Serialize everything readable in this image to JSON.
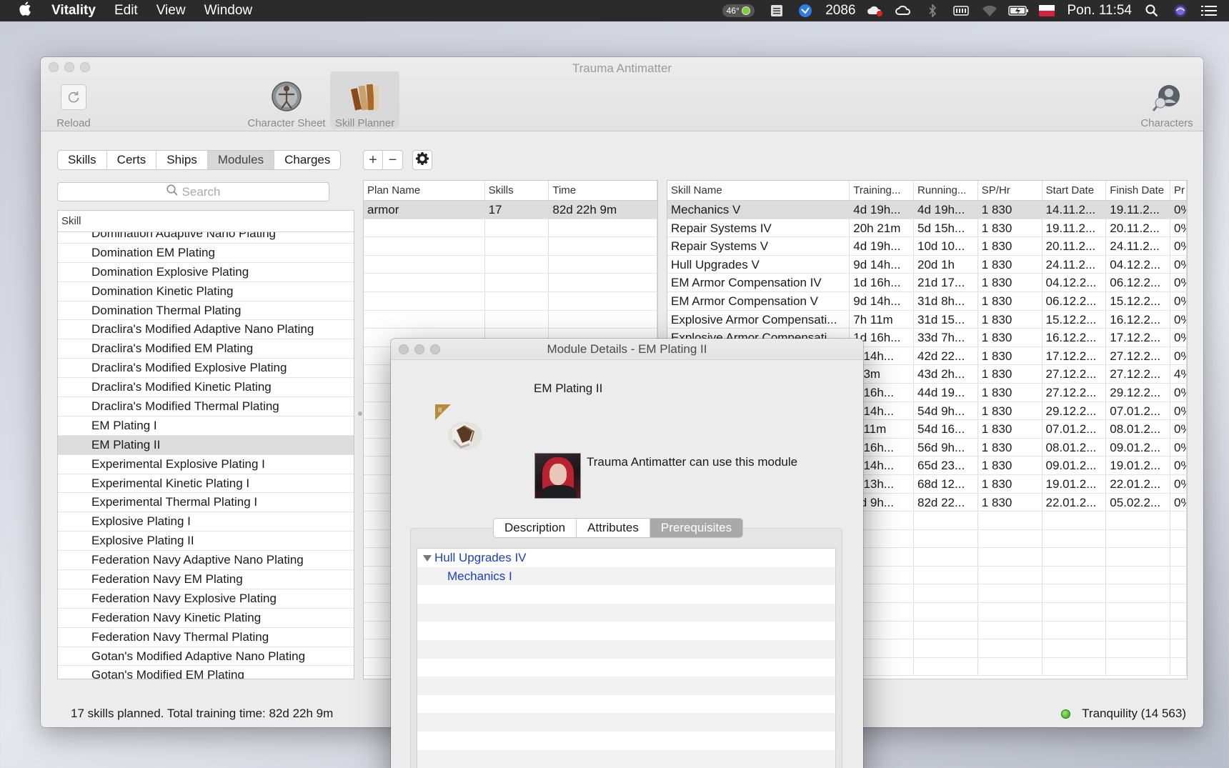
{
  "menubar": {
    "app": "Vitality",
    "menus": [
      "Edit",
      "View",
      "Window"
    ],
    "temp": "46°",
    "count": "2086",
    "clock": "Pon. 11:54"
  },
  "window": {
    "title": "Trauma Antimatter",
    "toolbar": {
      "reload": "Reload",
      "character_sheet": "Character Sheet",
      "skill_planner": "Skill Planner",
      "characters": "Characters"
    },
    "segments": [
      "Skills",
      "Certs",
      "Ships",
      "Modules",
      "Charges"
    ],
    "selected_segment": "Modules",
    "search_placeholder": "Search",
    "left_table": {
      "header": "Skill",
      "rows": [
        "Domination Adaptive Nano Plating",
        "Domination EM Plating",
        "Domination Explosive Plating",
        "Domination Kinetic Plating",
        "Domination Thermal Plating",
        "Draclira's Modified Adaptive Nano Plating",
        "Draclira's Modified EM Plating",
        "Draclira's Modified Explosive Plating",
        "Draclira's Modified Kinetic Plating",
        "Draclira's Modified Thermal Plating",
        "EM Plating I",
        "EM Plating II",
        "Experimental Explosive Plating I",
        "Experimental Kinetic Plating I",
        "Experimental Thermal Plating I",
        "Explosive Plating I",
        "Explosive Plating II",
        "Federation Navy Adaptive Nano Plating",
        "Federation Navy EM Plating",
        "Federation Navy Explosive Plating",
        "Federation Navy Kinetic Plating",
        "Federation Navy Thermal Plating",
        "Gotan's Modified Adaptive Nano Plating",
        "Gotan's Modified EM Plating"
      ],
      "selected": "EM Plating II"
    },
    "plan_table": {
      "headers": [
        "Plan Name",
        "Skills",
        "Time"
      ],
      "rows": [
        [
          "armor",
          "17",
          "82d 22h 9m"
        ]
      ]
    },
    "skill_table": {
      "headers": [
        "Skill Name",
        "Training...",
        "Running...",
        "SP/Hr",
        "Start Date",
        "Finish Date",
        "Pr"
      ],
      "rows": [
        [
          "Mechanics V",
          "4d 19h...",
          "4d 19h...",
          "1 830",
          "14.11.2...",
          "19.11.2...",
          "0%"
        ],
        [
          "Repair Systems IV",
          "20h 21m",
          "5d 15h...",
          "1 830",
          "19.11.2...",
          "20.11.2...",
          "0%"
        ],
        [
          "Repair Systems V",
          "4d 19h...",
          "10d 10...",
          "1 830",
          "20.11.2...",
          "24.11.2...",
          "0%"
        ],
        [
          "Hull Upgrades V",
          "9d 14h...",
          "20d 1h",
          "1 830",
          "24.11.2...",
          "04.12.2...",
          "0%"
        ],
        [
          "EM Armor Compensation IV",
          "1d 16h...",
          "21d 17...",
          "1 830",
          "04.12.2...",
          "06.12.2...",
          "0%"
        ],
        [
          "EM Armor Compensation V",
          "9d 14h...",
          "31d 8h...",
          "1 830",
          "06.12.2...",
          "15.12.2...",
          "0%"
        ],
        [
          "Explosive Armor Compensati...",
          "7h 11m",
          "31d 15...",
          "1 830",
          "15.12.2...",
          "16.12.2...",
          "0%"
        ],
        [
          "Explosive Armor Compensati...",
          "1d 16h...",
          "33d 7h...",
          "1 830",
          "16.12.2...",
          "17.12.2...",
          "0%"
        ],
        [
          "",
          "d 14h...",
          "42d 22...",
          "1 830",
          "17.12.2...",
          "27.12.2...",
          "0%"
        ],
        [
          "",
          "h 3m",
          "43d 2h...",
          "1 830",
          "27.12.2...",
          "27.12.2...",
          "4%"
        ],
        [
          "",
          "d 16h...",
          "44d 19...",
          "1 830",
          "27.12.2...",
          "29.12.2...",
          "0%"
        ],
        [
          "",
          "d 14h...",
          "54d 9h...",
          "1 830",
          "29.12.2...",
          "07.01.2...",
          "0%"
        ],
        [
          "",
          "h 11m",
          "54d 16...",
          "1 830",
          "07.01.2...",
          "08.01.2...",
          "0%"
        ],
        [
          "",
          "d 16h...",
          "56d 9h...",
          "1 830",
          "08.01.2...",
          "09.01.2...",
          "0%"
        ],
        [
          "",
          "d 14h...",
          "65d 23...",
          "1 830",
          "09.01.2...",
          "19.01.2...",
          "0%"
        ],
        [
          "",
          "d 13h...",
          "68d 12...",
          "1 830",
          "19.01.2...",
          "22.01.2...",
          "0%"
        ],
        [
          "",
          "4d 9h...",
          "82d 22...",
          "1 830",
          "22.01.2...",
          "05.02.2...",
          "0%"
        ]
      ]
    },
    "status_left": "17 skills planned. Total training time: 82d 22h 9m",
    "status_right": "Tranquility (14 563)"
  },
  "modal": {
    "title": "Module Details - EM Plating II",
    "module_name": "EM Plating II",
    "can_use": "Trauma Antimatter can use this module",
    "tabs": [
      "Description",
      "Attributes",
      "Prerequisites"
    ],
    "selected_tab": "Prerequisites",
    "prereqs": {
      "root": "Hull Upgrades IV",
      "child": "Mechanics I"
    }
  },
  "colors": {
    "link": "#1a3fc6",
    "status_online": "#3cb01c",
    "selection": "#dcdcdc"
  }
}
